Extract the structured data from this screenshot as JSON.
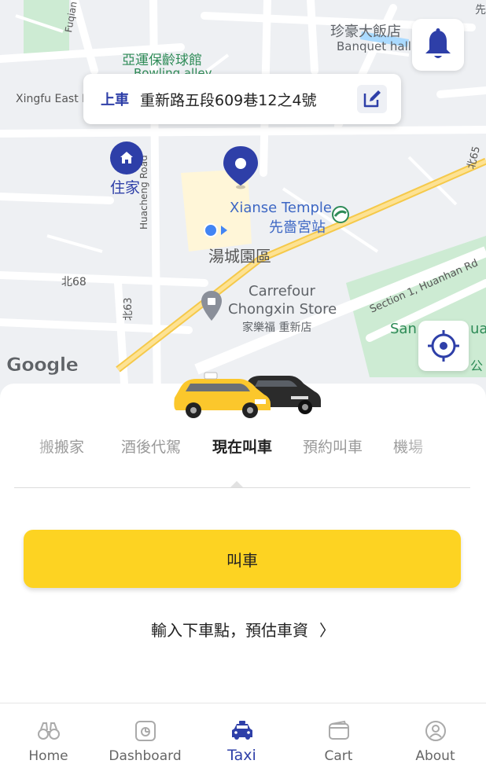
{
  "map": {
    "places": {
      "banquet_zh": "珍豪大飯店",
      "banquet_en": "Banquet hall",
      "bowling_zh": "亞運保齡球館",
      "bowling_en": "Bowling alley",
      "temple_en": "Xianse Temple",
      "temple_zh": "先嗇宮站",
      "district": "湯城園區",
      "carrefour_en1": "Carrefour",
      "carrefour_en2": "Chongxin Store",
      "carrefour_zh": "家樂福 重新店",
      "home_label": "住家",
      "san_partial": "San",
      "ua_partial": "ua",
      "gong_partial": "公",
      "corner_partial": "先"
    },
    "roads": {
      "fuqian": "Fuqian Street",
      "xingfu": "Xingfu East R",
      "huacheng": "Huacheng Road",
      "bei68": "北68",
      "bei63": "北63",
      "bei65": "北65",
      "huanhan": "Section 1, Huanhan Rd"
    },
    "google_logo": "Google",
    "colors": {
      "water": "#aadaff",
      "park": "#cdebd3",
      "highway": "#fbd35a",
      "pin": "#2e3fa8",
      "my_location": "#4285f4"
    }
  },
  "pickup": {
    "tag": "上車",
    "address": "重新路五段609巷12之4號",
    "edit_icon": "edit-icon"
  },
  "notification_icon": "bell-icon",
  "locate_icon": "crosshair-icon",
  "service_tabs": [
    {
      "label": "搬搬家",
      "active": false
    },
    {
      "label": "酒後代駕",
      "active": false
    },
    {
      "label": "現在叫車",
      "active": true
    },
    {
      "label": "預約叫車",
      "active": false
    },
    {
      "label": "機場",
      "active": false
    }
  ],
  "call_button": {
    "label": "叫車",
    "color": "#fdd322"
  },
  "dropoff_prompt": {
    "label": "輸入下車點，預估車資",
    "chevron": "〉"
  },
  "bottom_nav": [
    {
      "label": "Home",
      "icon": "binoculars-icon",
      "active": false
    },
    {
      "label": "Dashboard",
      "icon": "chart-icon",
      "active": false
    },
    {
      "label": "Taxi",
      "icon": "taxi-icon",
      "active": true
    },
    {
      "label": "Cart",
      "icon": "wallet-icon",
      "active": false
    },
    {
      "label": "About",
      "icon": "user-icon",
      "active": false
    }
  ]
}
